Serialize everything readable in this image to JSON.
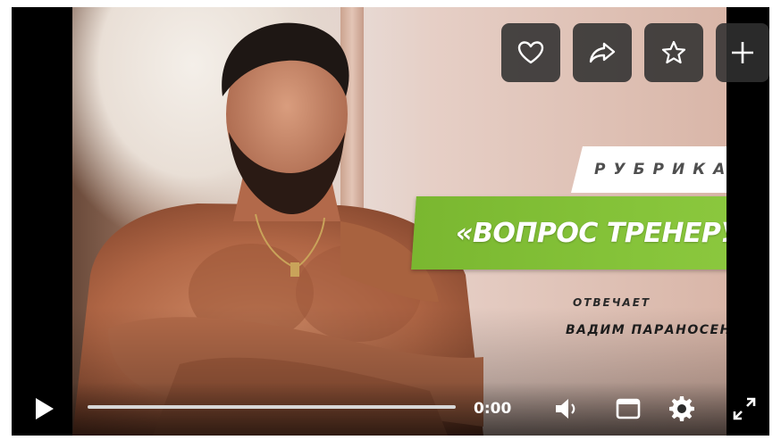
{
  "overlay_actions": [
    {
      "icon": "heart-icon",
      "name": "like-button"
    },
    {
      "icon": "share-arrow-icon",
      "name": "share-button"
    },
    {
      "icon": "star-icon",
      "name": "favorite-button"
    },
    {
      "icon": "plus-icon",
      "name": "add-button"
    }
  ],
  "thumbnail": {
    "rubric_label": "РУБРИКА",
    "title": "«ВОПРОС ТРЕНЕРУ»",
    "answers_label": "ОТВЕЧАЕТ",
    "coach_name": "ВАДИМ ПАРАНОСЕНКОВ"
  },
  "controls": {
    "time": "0:00",
    "progress": 0,
    "icons": [
      "play-icon",
      "volume-icon",
      "miniplayer-icon",
      "settings-gear-icon",
      "fullscreen-icon"
    ]
  },
  "colors": {
    "accent_green": "#86c43a",
    "button_bg": "#303030",
    "player_bg": "#000000"
  }
}
